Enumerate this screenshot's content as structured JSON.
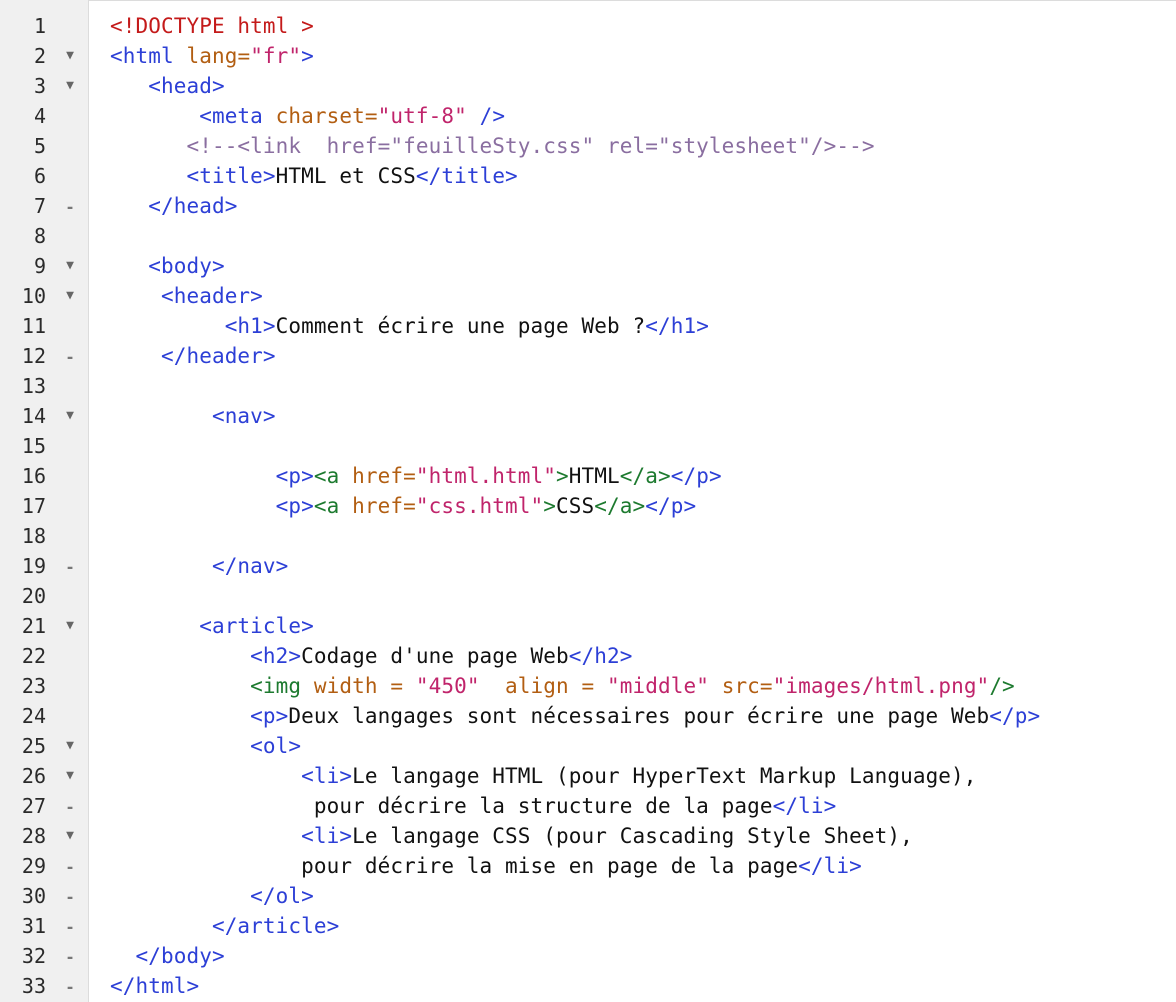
{
  "editor": {
    "lines": [
      {
        "n": "1",
        "fold": "",
        "segs": [
          {
            "t": "<!DOCTYPE html >",
            "c": "doc"
          }
        ]
      },
      {
        "n": "2",
        "fold": "open",
        "segs": [
          {
            "t": "<html ",
            "c": "tag"
          },
          {
            "t": "lang=",
            "c": "attr"
          },
          {
            "t": "\"fr\"",
            "c": "str"
          },
          {
            "t": ">",
            "c": "tag"
          }
        ]
      },
      {
        "n": "3",
        "fold": "open",
        "segs": [
          {
            "t": "   <head>",
            "c": "tag"
          }
        ]
      },
      {
        "n": "4",
        "fold": "",
        "segs": [
          {
            "t": "       <meta ",
            "c": "tag"
          },
          {
            "t": "charset=",
            "c": "attr"
          },
          {
            "t": "\"utf-8\"",
            "c": "str"
          },
          {
            "t": " />",
            "c": "tag"
          }
        ]
      },
      {
        "n": "5",
        "fold": "",
        "segs": [
          {
            "t": "      <!--<link  href=\"feuilleSty.css\" rel=\"stylesheet\"/>-->",
            "c": "cmt"
          }
        ]
      },
      {
        "n": "6",
        "fold": "",
        "segs": [
          {
            "t": "      <title>",
            "c": "tag"
          },
          {
            "t": "HTML et CSS",
            "c": "txt"
          },
          {
            "t": "</title>",
            "c": "tag"
          }
        ]
      },
      {
        "n": "7",
        "fold": "end",
        "segs": [
          {
            "t": "   </head>",
            "c": "tag"
          }
        ]
      },
      {
        "n": "8",
        "fold": "",
        "segs": []
      },
      {
        "n": "9",
        "fold": "open",
        "segs": [
          {
            "t": "   <body>",
            "c": "tag"
          }
        ]
      },
      {
        "n": "10",
        "fold": "open",
        "segs": [
          {
            "t": "    <header>",
            "c": "tag"
          }
        ]
      },
      {
        "n": "11",
        "fold": "",
        "segs": [
          {
            "t": "         <h1>",
            "c": "tag"
          },
          {
            "t": "Comment écrire une page Web ?",
            "c": "txt"
          },
          {
            "t": "</h1>",
            "c": "tag"
          }
        ]
      },
      {
        "n": "12",
        "fold": "end",
        "segs": [
          {
            "t": "    </header>",
            "c": "tag"
          }
        ]
      },
      {
        "n": "13",
        "fold": "",
        "segs": []
      },
      {
        "n": "14",
        "fold": "open",
        "segs": [
          {
            "t": "        <nav>",
            "c": "tag"
          }
        ]
      },
      {
        "n": "15",
        "fold": "",
        "segs": []
      },
      {
        "n": "16",
        "fold": "",
        "segs": [
          {
            "t": "             <p>",
            "c": "tag"
          },
          {
            "t": "<a ",
            "c": "tagg"
          },
          {
            "t": "href=",
            "c": "attr"
          },
          {
            "t": "\"html.html\"",
            "c": "str"
          },
          {
            "t": ">",
            "c": "tagg"
          },
          {
            "t": "HTML",
            "c": "txt"
          },
          {
            "t": "</a>",
            "c": "tagg"
          },
          {
            "t": "</p>",
            "c": "tag"
          }
        ]
      },
      {
        "n": "17",
        "fold": "",
        "segs": [
          {
            "t": "             <p>",
            "c": "tag"
          },
          {
            "t": "<a ",
            "c": "tagg"
          },
          {
            "t": "href=",
            "c": "attr"
          },
          {
            "t": "\"css.html\"",
            "c": "str"
          },
          {
            "t": ">",
            "c": "tagg"
          },
          {
            "t": "CSS",
            "c": "txt"
          },
          {
            "t": "</a>",
            "c": "tagg"
          },
          {
            "t": "</p>",
            "c": "tag"
          }
        ]
      },
      {
        "n": "18",
        "fold": "",
        "segs": []
      },
      {
        "n": "19",
        "fold": "end",
        "segs": [
          {
            "t": "        </nav>",
            "c": "tag"
          }
        ]
      },
      {
        "n": "20",
        "fold": "",
        "segs": []
      },
      {
        "n": "21",
        "fold": "open",
        "segs": [
          {
            "t": "       <article>",
            "c": "tag"
          }
        ]
      },
      {
        "n": "22",
        "fold": "",
        "segs": [
          {
            "t": "           <h2>",
            "c": "tag"
          },
          {
            "t": "Codage d'une page Web",
            "c": "txt"
          },
          {
            "t": "</h2>",
            "c": "tag"
          }
        ]
      },
      {
        "n": "23",
        "fold": "",
        "segs": [
          {
            "t": "           <img ",
            "c": "tagg"
          },
          {
            "t": "width = ",
            "c": "attr"
          },
          {
            "t": "\"450\"",
            "c": "str"
          },
          {
            "t": "  align = ",
            "c": "attr"
          },
          {
            "t": "\"middle\"",
            "c": "str"
          },
          {
            "t": " src=",
            "c": "attr"
          },
          {
            "t": "\"images/html.png\"",
            "c": "str"
          },
          {
            "t": "/>",
            "c": "tagg"
          }
        ]
      },
      {
        "n": "24",
        "fold": "",
        "segs": [
          {
            "t": "           <p>",
            "c": "tag"
          },
          {
            "t": "Deux langages sont nécessaires pour écrire une page Web",
            "c": "txt"
          },
          {
            "t": "</p>",
            "c": "tag"
          }
        ]
      },
      {
        "n": "25",
        "fold": "open",
        "segs": [
          {
            "t": "           <ol>",
            "c": "tag"
          }
        ]
      },
      {
        "n": "26",
        "fold": "open",
        "segs": [
          {
            "t": "               <li>",
            "c": "tag"
          },
          {
            "t": "Le langage HTML (pour HyperText Markup Language),",
            "c": "txt"
          }
        ]
      },
      {
        "n": "27",
        "fold": "end",
        "segs": [
          {
            "t": "                pour décrire la structure de la page",
            "c": "txt"
          },
          {
            "t": "</li>",
            "c": "tag"
          }
        ]
      },
      {
        "n": "28",
        "fold": "open",
        "segs": [
          {
            "t": "               <li>",
            "c": "tag"
          },
          {
            "t": "Le langage CSS (pour Cascading Style Sheet),",
            "c": "txt"
          }
        ]
      },
      {
        "n": "29",
        "fold": "end",
        "segs": [
          {
            "t": "               pour décrire la mise en page de la page",
            "c": "txt"
          },
          {
            "t": "</li>",
            "c": "tag"
          }
        ]
      },
      {
        "n": "30",
        "fold": "end",
        "segs": [
          {
            "t": "           </ol>",
            "c": "tag"
          }
        ]
      },
      {
        "n": "31",
        "fold": "end",
        "segs": [
          {
            "t": "        </article>",
            "c": "tag"
          }
        ]
      },
      {
        "n": "32",
        "fold": "end",
        "segs": [
          {
            "t": "  </body>",
            "c": "tag"
          }
        ]
      },
      {
        "n": "33",
        "fold": "end",
        "segs": [
          {
            "t": "</html>",
            "c": "tag"
          }
        ]
      }
    ],
    "fold_icons": {
      "open": "fold-open-icon",
      "end": "fold-end-icon"
    },
    "colors": {
      "tag": "#2c3fd6",
      "tag_anchor_img": "#1d7a2f",
      "attribute": "#b25e12",
      "string": "#c0246b",
      "doctype": "#c41a1a",
      "comment": "#8a6ea0",
      "text": "#111111",
      "gutter_bg": "#f0f0f0"
    }
  }
}
